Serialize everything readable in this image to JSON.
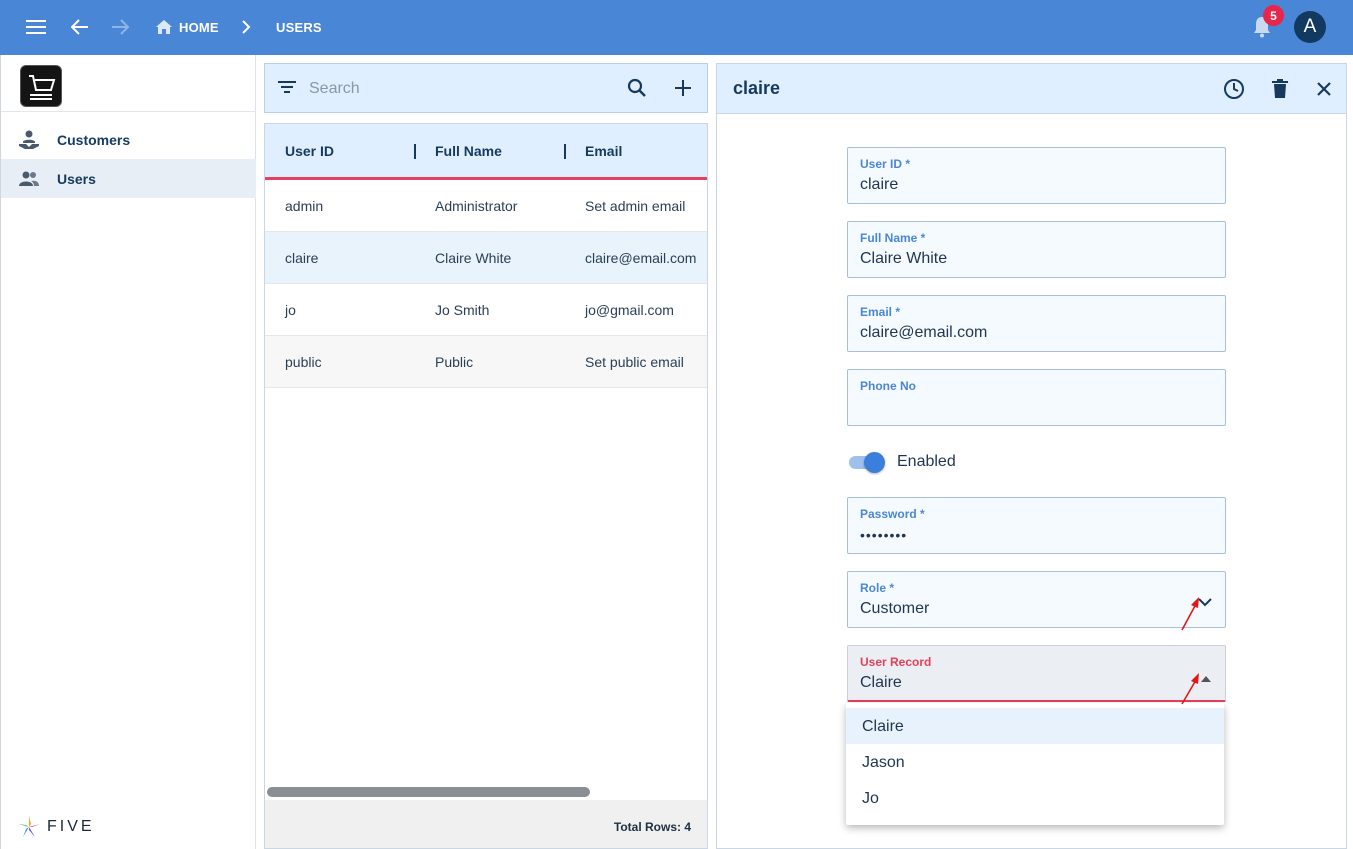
{
  "topbar": {
    "breadcrumb_home": "HOME",
    "breadcrumb_users": "USERS",
    "notification_count": "5",
    "avatar_initial": "A"
  },
  "sidebar": {
    "items": [
      {
        "label": "Customers",
        "icon": "customers-icon",
        "active": false
      },
      {
        "label": "Users",
        "icon": "users-icon",
        "active": true
      }
    ],
    "brand": "FIVE"
  },
  "list": {
    "search_placeholder": "Search",
    "columns": [
      "User ID",
      "Full Name",
      "Email"
    ],
    "rows": [
      {
        "user_id": "admin",
        "full_name": "Administrator",
        "email": "Set admin email"
      },
      {
        "user_id": "claire",
        "full_name": "Claire White",
        "email": "claire@email.com"
      },
      {
        "user_id": "jo",
        "full_name": "Jo Smith",
        "email": "jo@gmail.com"
      },
      {
        "user_id": "public",
        "full_name": "Public",
        "email": "Set public email"
      }
    ],
    "total_rows": "Total Rows: 4"
  },
  "form": {
    "title": "claire",
    "fields": {
      "user_id": {
        "label": "User ID *",
        "value": "claire"
      },
      "full_name": {
        "label": "Full Name *",
        "value": "Claire White"
      },
      "email": {
        "label": "Email *",
        "value": "claire@email.com"
      },
      "phone": {
        "label": "Phone No",
        "value": ""
      },
      "enabled": {
        "label": "Enabled",
        "value": true
      },
      "password": {
        "label": "Password *",
        "value": "••••••••"
      },
      "role": {
        "label": "Role *",
        "value": "Customer"
      },
      "user_record": {
        "label": "User Record",
        "value": "Claire"
      }
    },
    "user_record_options": [
      "Claire",
      "Jason",
      "Jo"
    ]
  },
  "colors": {
    "topbar": "#4a86d6",
    "accent_red": "#e6405e",
    "panel_blue": "#e0efff",
    "dark_text": "#163a5e"
  }
}
